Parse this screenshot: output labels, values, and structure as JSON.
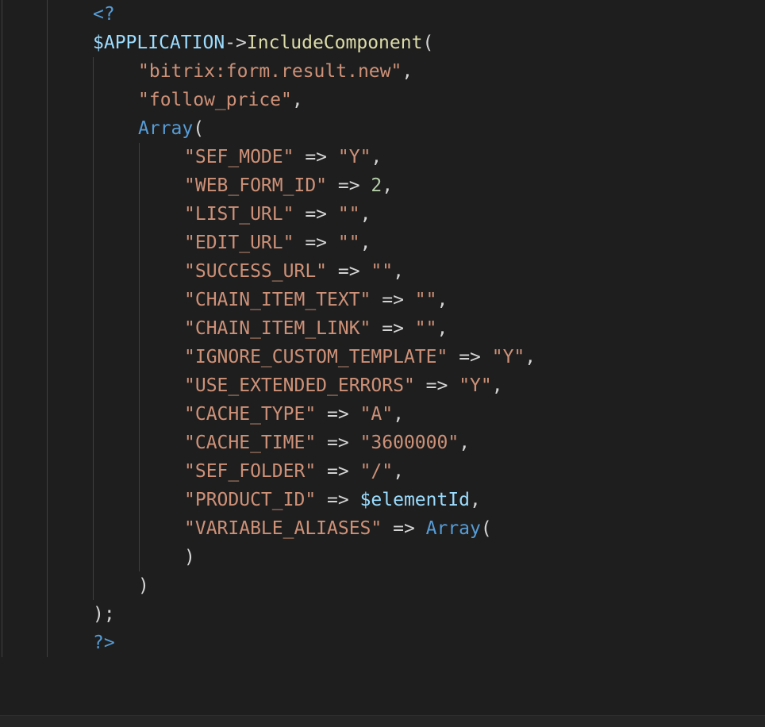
{
  "editor": {
    "lines": [
      [
        {
          "t": "<?",
          "c": "k"
        }
      ],
      [
        {
          "t": "$APPLICATION",
          "c": "v"
        },
        {
          "t": "->",
          "c": "p"
        },
        {
          "t": "IncludeComponent",
          "c": "f"
        },
        {
          "t": "(",
          "c": "p"
        }
      ],
      [
        {
          "t": "\"bitrix:form.result.new\"",
          "c": "s"
        },
        {
          "t": ",",
          "c": "p"
        }
      ],
      [
        {
          "t": "\"follow_price\"",
          "c": "s"
        },
        {
          "t": ",",
          "c": "p"
        }
      ],
      [
        {
          "t": "Array",
          "c": "k"
        },
        {
          "t": "(",
          "c": "p"
        }
      ],
      [
        {
          "t": "\"SEF_MODE\"",
          "c": "s"
        },
        {
          "t": " => ",
          "c": "p"
        },
        {
          "t": "\"Y\"",
          "c": "s"
        },
        {
          "t": ",",
          "c": "p"
        }
      ],
      [
        {
          "t": "\"WEB_FORM_ID\"",
          "c": "s"
        },
        {
          "t": " => ",
          "c": "p"
        },
        {
          "t": "2",
          "c": "n"
        },
        {
          "t": ",",
          "c": "p"
        }
      ],
      [
        {
          "t": "\"LIST_URL\"",
          "c": "s"
        },
        {
          "t": " => ",
          "c": "p"
        },
        {
          "t": "\"\"",
          "c": "s"
        },
        {
          "t": ",",
          "c": "p"
        }
      ],
      [
        {
          "t": "\"EDIT_URL\"",
          "c": "s"
        },
        {
          "t": " => ",
          "c": "p"
        },
        {
          "t": "\"\"",
          "c": "s"
        },
        {
          "t": ",",
          "c": "p"
        }
      ],
      [
        {
          "t": "\"SUCCESS_URL\"",
          "c": "s"
        },
        {
          "t": " => ",
          "c": "p"
        },
        {
          "t": "\"\"",
          "c": "s"
        },
        {
          "t": ",",
          "c": "p"
        }
      ],
      [
        {
          "t": "\"CHAIN_ITEM_TEXT\"",
          "c": "s"
        },
        {
          "t": " => ",
          "c": "p"
        },
        {
          "t": "\"\"",
          "c": "s"
        },
        {
          "t": ",",
          "c": "p"
        }
      ],
      [
        {
          "t": "\"CHAIN_ITEM_LINK\"",
          "c": "s"
        },
        {
          "t": " => ",
          "c": "p"
        },
        {
          "t": "\"\"",
          "c": "s"
        },
        {
          "t": ",",
          "c": "p"
        }
      ],
      [
        {
          "t": "\"IGNORE_CUSTOM_TEMPLATE\"",
          "c": "s"
        },
        {
          "t": " => ",
          "c": "p"
        },
        {
          "t": "\"Y\"",
          "c": "s"
        },
        {
          "t": ",",
          "c": "p"
        }
      ],
      [
        {
          "t": "\"USE_EXTENDED_ERRORS\"",
          "c": "s"
        },
        {
          "t": " => ",
          "c": "p"
        },
        {
          "t": "\"Y\"",
          "c": "s"
        },
        {
          "t": ",",
          "c": "p"
        }
      ],
      [
        {
          "t": "\"CACHE_TYPE\"",
          "c": "s"
        },
        {
          "t": " => ",
          "c": "p"
        },
        {
          "t": "\"A\"",
          "c": "s"
        },
        {
          "t": ",",
          "c": "p"
        }
      ],
      [
        {
          "t": "\"CACHE_TIME\"",
          "c": "s"
        },
        {
          "t": " => ",
          "c": "p"
        },
        {
          "t": "\"3600000\"",
          "c": "s"
        },
        {
          "t": ",",
          "c": "p"
        }
      ],
      [
        {
          "t": "\"SEF_FOLDER\"",
          "c": "s"
        },
        {
          "t": " => ",
          "c": "p"
        },
        {
          "t": "\"/\"",
          "c": "s"
        },
        {
          "t": ",",
          "c": "p"
        }
      ],
      [
        {
          "t": "\"PRODUCT_ID\"",
          "c": "s"
        },
        {
          "t": " => ",
          "c": "p"
        },
        {
          "t": "$elementId",
          "c": "v"
        },
        {
          "t": ",",
          "c": "p"
        }
      ],
      [
        {
          "t": "\"VARIABLE_ALIASES\"",
          "c": "s"
        },
        {
          "t": " => ",
          "c": "p"
        },
        {
          "t": "Array",
          "c": "k"
        },
        {
          "t": "(",
          "c": "p"
        }
      ],
      [
        {
          "t": ")",
          "c": "p"
        }
      ],
      [
        {
          "t": ")",
          "c": "p"
        }
      ],
      [
        {
          "t": ");",
          "c": "p"
        }
      ],
      [
        {
          "t": "?>",
          "c": "k"
        }
      ]
    ]
  }
}
